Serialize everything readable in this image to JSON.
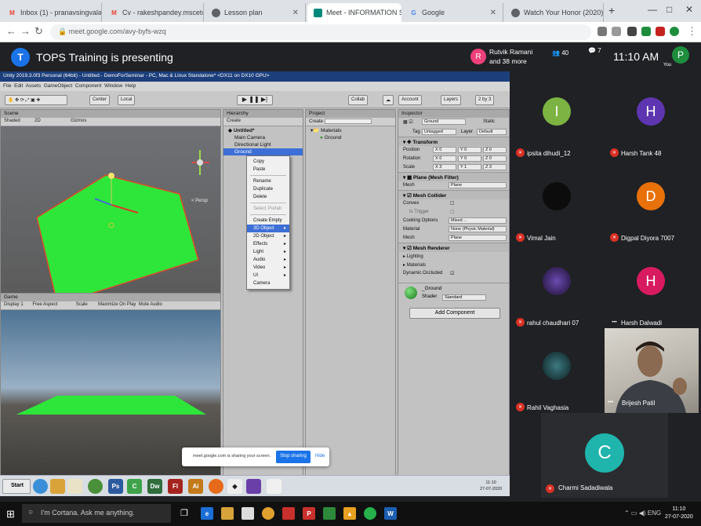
{
  "browser": {
    "tabs": [
      {
        "label": "Inbox (1) - pranavsingvala.m",
        "fav": "M",
        "color": "#ea4335"
      },
      {
        "label": "Cv - rakeshpandey.mscet@b",
        "fav": "M",
        "color": "#ea4335"
      },
      {
        "label": "Lesson plan",
        "fav": "",
        "color": "#5f6368"
      },
      {
        "label": "Meet - INFORMATION SI",
        "fav": "",
        "color": "#00897b"
      },
      {
        "label": "Google",
        "fav": "G",
        "color": "#4285f4"
      },
      {
        "label": "Watch Your Honor (2020) Sea",
        "fav": "",
        "color": "#5f6368"
      }
    ],
    "new_tab": "+",
    "url": "meet.google.com/avy-byfs-wzq"
  },
  "meet": {
    "presenter_initial": "T",
    "presenting_text": "TOPS Training is presenting",
    "raised_initial": "R",
    "raised_name": "Rutvik Ramani",
    "raised_more": "and 38 more",
    "people_count": "40",
    "chat_count": "7",
    "clock": "11:10 AM",
    "me_initial": "P",
    "me_label": "You",
    "participants": [
      {
        "initial": "I",
        "name": "ipsita dihudi_12",
        "color": "#7cb342"
      },
      {
        "initial": "H",
        "name": "Harsh Tank 48",
        "color": "#5e35b1"
      },
      {
        "initial": "",
        "name": "Vimal Jain",
        "color": "#111111"
      },
      {
        "initial": "D",
        "name": "Digpal Diyora 7007",
        "color": "#e8710a"
      },
      {
        "initial": "",
        "name": "rahul chaudhari 07",
        "color": "#3a2a6a"
      },
      {
        "initial": "H",
        "name": "Harsh Dalwadi",
        "color": "#d81b60"
      },
      {
        "initial": "",
        "name": "Rahil Vaghasia",
        "color": "#1d3b40"
      }
    ],
    "video_name": "Brijesh Patil",
    "big_initial": "C",
    "big_name": "Charmi Sadadiwala",
    "share_text": "meet.google.com is sharing your screen.",
    "stop_label": "Stop sharing",
    "hide_label": "Hide"
  },
  "unity": {
    "title": "Unity 2019.3.0f3 Personal (64bit) - Untitled - DemoForSeminar - PC, Mac & Linux Standalone* <DX11 on DX10 GPU>",
    "menu": [
      "File",
      "Edit",
      "Assets",
      "GameObject",
      "Component",
      "Window",
      "Help"
    ],
    "center_label": "Center",
    "local_label": "Local",
    "collab_label": "Collab",
    "account_label": "Account",
    "layers_label": "Layers",
    "layout_label": "2 by 3",
    "scene_tab": "Scene",
    "shaded": "Shaded",
    "mode_2d": "2D",
    "gizmos": "Gizmos",
    "persp": "< Persp",
    "game_tab": "Game",
    "display": "Display 1",
    "aspect": "Free Aspect",
    "scale": "Scale",
    "maximize": "Maximize On Play",
    "mute": "Mute Audio",
    "hierarchy_tab": "Hierarchy",
    "create_label": "Create",
    "h_root": "Untitled*",
    "h_items": [
      "Main Camera",
      "Directional Light",
      "Ground"
    ],
    "project_tab": "Project",
    "p_folder": "Materials",
    "p_item": "Ground",
    "context_menu": [
      {
        "label": "Copy",
        "dis": false,
        "arr": false
      },
      {
        "label": "Paste",
        "dis": false,
        "arr": false
      },
      {
        "sep": true
      },
      {
        "label": "Rename",
        "dis": false,
        "arr": false
      },
      {
        "label": "Duplicate",
        "dis": false,
        "arr": false
      },
      {
        "label": "Delete",
        "dis": false,
        "arr": false
      },
      {
        "sep": true
      },
      {
        "label": "Select Prefab",
        "dis": true,
        "arr": false
      },
      {
        "sep": true
      },
      {
        "label": "Create Empty",
        "dis": false,
        "arr": false
      },
      {
        "label": "3D Object",
        "dis": false,
        "arr": true,
        "sel": true
      },
      {
        "label": "2D Object",
        "dis": false,
        "arr": true
      },
      {
        "label": "Effects",
        "dis": false,
        "arr": true
      },
      {
        "label": "Light",
        "dis": false,
        "arr": true
      },
      {
        "label": "Audio",
        "dis": false,
        "arr": true
      },
      {
        "label": "Video",
        "dis": false,
        "arr": true
      },
      {
        "label": "UI",
        "dis": false,
        "arr": true
      },
      {
        "label": "Camera",
        "dis": false,
        "arr": false
      }
    ],
    "inspector_tab": "Inspector",
    "obj_name": "Ground",
    "static_label": "Static",
    "tag_label": "Tag",
    "tag_value": "Untagged",
    "layer_label": "Layer",
    "layer_value": "Default",
    "transform": "Transform",
    "position": "Position",
    "rotation": "Rotation",
    "scale_row": "Scale",
    "pos": [
      "X 0",
      "Y 0",
      "Z 0"
    ],
    "rot": [
      "X 0",
      "Y 0",
      "Z 0"
    ],
    "scl": [
      "X 3",
      "Y 1",
      "Z 3"
    ],
    "mesh_filter": "Plane (Mesh Filter)",
    "mesh_label": "Mesh",
    "mesh_value": "Plane",
    "mesh_collider": "Mesh Collider",
    "convex": "Convex",
    "is_trigger": "Is Trigger",
    "cooking": "Cooking Options",
    "cooking_value": "Mixed ...",
    "material": "Material",
    "material_value": "None (Physic Material)",
    "mesh_renderer": "Mesh Renderer",
    "lighting": "Lighting",
    "materials": "Materials",
    "dynamic_occluded": "Dynamic Occluded",
    "mat_name": "_Ground",
    "shader_label": "Shader",
    "shader_value": "Standard",
    "add_component": "Add Component"
  },
  "inner_taskbar": {
    "start": "Start",
    "time": "11:10",
    "date": "27-07-2020"
  },
  "taskbar": {
    "search": "I'm Cortana. Ask me anything.",
    "time": "11:10",
    "date": "27-07-2020"
  }
}
